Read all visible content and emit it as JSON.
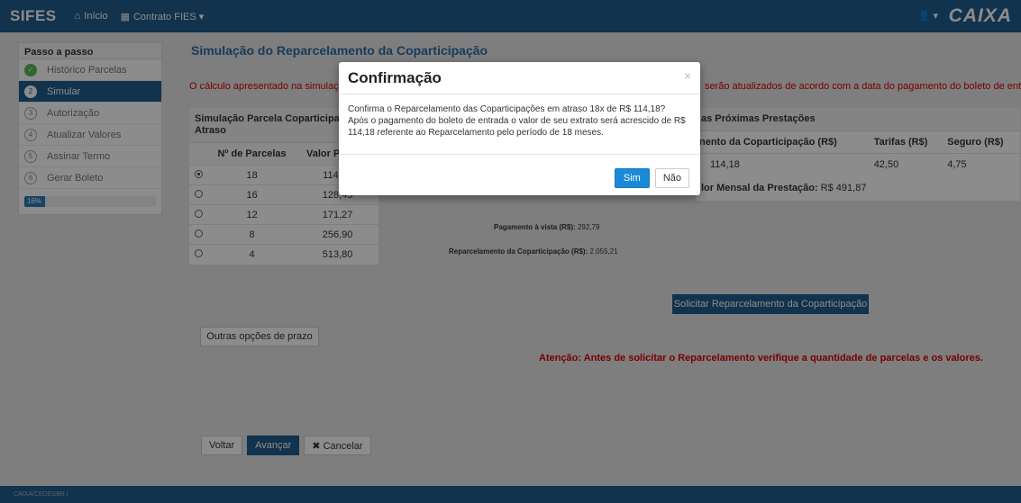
{
  "navbar": {
    "brand": "SIFES",
    "items": [
      {
        "icon": "home-icon",
        "label": "Início"
      },
      {
        "icon": "grid-icon",
        "label": "Contrato FIES ▾"
      }
    ],
    "user_menu": "👤 ▾",
    "logo": "CAIXA"
  },
  "sidebar": {
    "title": "Passo a passo",
    "steps": [
      {
        "num": "✓",
        "label": "Histórico Parcelas"
      },
      {
        "num": "2",
        "label": "Simular"
      },
      {
        "num": "3",
        "label": "Autorização"
      },
      {
        "num": "4",
        "label": "Atualizar Valores"
      },
      {
        "num": "5",
        "label": "Assinar Termo"
      },
      {
        "num": "6",
        "label": "Gerar Boleto"
      }
    ],
    "progress_label": "16%",
    "progress_value": 16
  },
  "main": {
    "title": "Simulação do Reparcelamento da Coparticipação",
    "warn_left": "O cálculo apresentado na simulação",
    "warn_right": "serão atualizados de acordo com a data do pagamento do boleto de entrada.",
    "left_panel": {
      "heading": "Simulação Parcela Coparticipação Atraso",
      "col_parcelas": "Nº de Parcelas",
      "col_valor": "Valor Parcela",
      "rows": [
        {
          "parcelas": "18",
          "valor": "114,18",
          "selected": true
        },
        {
          "parcelas": "16",
          "valor": "128,45",
          "selected": false
        },
        {
          "parcelas": "12",
          "valor": "171,27",
          "selected": false
        },
        {
          "parcelas": "8",
          "valor": "256,90",
          "selected": false
        },
        {
          "parcelas": "4",
          "valor": "513,80",
          "selected": false
        }
      ],
      "outras_btn": "Outras opções de prazo"
    },
    "right_panel": {
      "heading": "as Próximas Prestações",
      "col1": "nento da Coparticipação (R$)",
      "col2": "Tarifas (R$)",
      "col3": "Seguro (R$)",
      "val1": "114,18",
      "val2": "42,50",
      "val3": "4,75",
      "total_label": "lor Mensal da Prestação:",
      "total_value": "R$ 491,87"
    },
    "pagamento_label": "Pagamento à vista (R$):",
    "pagamento_value": "292,79",
    "reparcelamento_label": "Reparcelamento da Coparticipação (R$):",
    "reparcelamento_value": "2.055,21",
    "solicitar_btn": "Solicitar Reparcelamento da Coparticipação",
    "atencao": "Atenção: Antes de solicitar o Reparcelamento verifique a quantidade de parcelas e os valores.",
    "btn_voltar": "Voltar",
    "btn_avancar": "Avançar",
    "btn_cancelar": "✖ Cancelar"
  },
  "footer_text": "CAIXA/CEDESBR I",
  "modal": {
    "title": "Confirmação",
    "close": "×",
    "body_line1": "Confirma o Reparcelamento das Coparticipações em atraso 18x de R$ 114,18?",
    "body_line2": "Após o pagamento do boleto de entrada o valor de seu extrato será acrescido de R$ 114,18 referente ao Reparcelamento pelo período de 18 meses.",
    "btn_sim": "Sim",
    "btn_nao": "Não"
  }
}
